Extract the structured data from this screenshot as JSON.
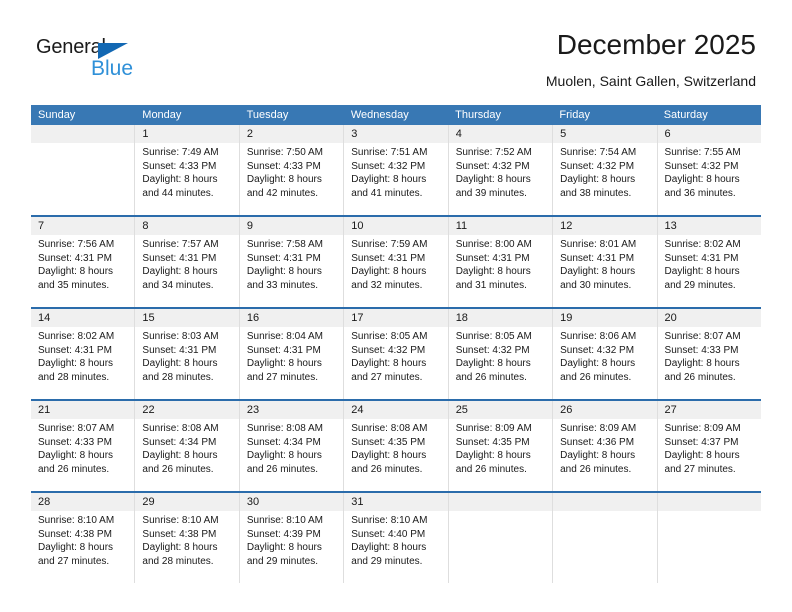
{
  "brand": {
    "name_top": "General",
    "name_bottom": "Blue",
    "accent_color": "#1268b3",
    "accent_color_light": "#2f90d8"
  },
  "header": {
    "title": "December 2025",
    "subtitle": "Muolen, Saint Gallen, Switzerland"
  },
  "theme": {
    "header_row_bg": "#3878b4",
    "week_separator": "#2b6cab",
    "day_number_band_bg": "#f0f0f0",
    "text": "#1a1a1a"
  },
  "weekdays": [
    "Sunday",
    "Monday",
    "Tuesday",
    "Wednesday",
    "Thursday",
    "Friday",
    "Saturday"
  ],
  "weeks": [
    [
      {
        "day": "",
        "sunrise": "",
        "sunset": "",
        "daylight_line1": "",
        "daylight_line2": "",
        "empty": true
      },
      {
        "day": "1",
        "sunrise": "Sunrise: 7:49 AM",
        "sunset": "Sunset: 4:33 PM",
        "daylight_line1": "Daylight: 8 hours",
        "daylight_line2": "and 44 minutes."
      },
      {
        "day": "2",
        "sunrise": "Sunrise: 7:50 AM",
        "sunset": "Sunset: 4:33 PM",
        "daylight_line1": "Daylight: 8 hours",
        "daylight_line2": "and 42 minutes."
      },
      {
        "day": "3",
        "sunrise": "Sunrise: 7:51 AM",
        "sunset": "Sunset: 4:32 PM",
        "daylight_line1": "Daylight: 8 hours",
        "daylight_line2": "and 41 minutes."
      },
      {
        "day": "4",
        "sunrise": "Sunrise: 7:52 AM",
        "sunset": "Sunset: 4:32 PM",
        "daylight_line1": "Daylight: 8 hours",
        "daylight_line2": "and 39 minutes."
      },
      {
        "day": "5",
        "sunrise": "Sunrise: 7:54 AM",
        "sunset": "Sunset: 4:32 PM",
        "daylight_line1": "Daylight: 8 hours",
        "daylight_line2": "and 38 minutes."
      },
      {
        "day": "6",
        "sunrise": "Sunrise: 7:55 AM",
        "sunset": "Sunset: 4:32 PM",
        "daylight_line1": "Daylight: 8 hours",
        "daylight_line2": "and 36 minutes."
      }
    ],
    [
      {
        "day": "7",
        "sunrise": "Sunrise: 7:56 AM",
        "sunset": "Sunset: 4:31 PM",
        "daylight_line1": "Daylight: 8 hours",
        "daylight_line2": "and 35 minutes."
      },
      {
        "day": "8",
        "sunrise": "Sunrise: 7:57 AM",
        "sunset": "Sunset: 4:31 PM",
        "daylight_line1": "Daylight: 8 hours",
        "daylight_line2": "and 34 minutes."
      },
      {
        "day": "9",
        "sunrise": "Sunrise: 7:58 AM",
        "sunset": "Sunset: 4:31 PM",
        "daylight_line1": "Daylight: 8 hours",
        "daylight_line2": "and 33 minutes."
      },
      {
        "day": "10",
        "sunrise": "Sunrise: 7:59 AM",
        "sunset": "Sunset: 4:31 PM",
        "daylight_line1": "Daylight: 8 hours",
        "daylight_line2": "and 32 minutes."
      },
      {
        "day": "11",
        "sunrise": "Sunrise: 8:00 AM",
        "sunset": "Sunset: 4:31 PM",
        "daylight_line1": "Daylight: 8 hours",
        "daylight_line2": "and 31 minutes."
      },
      {
        "day": "12",
        "sunrise": "Sunrise: 8:01 AM",
        "sunset": "Sunset: 4:31 PM",
        "daylight_line1": "Daylight: 8 hours",
        "daylight_line2": "and 30 minutes."
      },
      {
        "day": "13",
        "sunrise": "Sunrise: 8:02 AM",
        "sunset": "Sunset: 4:31 PM",
        "daylight_line1": "Daylight: 8 hours",
        "daylight_line2": "and 29 minutes."
      }
    ],
    [
      {
        "day": "14",
        "sunrise": "Sunrise: 8:02 AM",
        "sunset": "Sunset: 4:31 PM",
        "daylight_line1": "Daylight: 8 hours",
        "daylight_line2": "and 28 minutes."
      },
      {
        "day": "15",
        "sunrise": "Sunrise: 8:03 AM",
        "sunset": "Sunset: 4:31 PM",
        "daylight_line1": "Daylight: 8 hours",
        "daylight_line2": "and 28 minutes."
      },
      {
        "day": "16",
        "sunrise": "Sunrise: 8:04 AM",
        "sunset": "Sunset: 4:31 PM",
        "daylight_line1": "Daylight: 8 hours",
        "daylight_line2": "and 27 minutes."
      },
      {
        "day": "17",
        "sunrise": "Sunrise: 8:05 AM",
        "sunset": "Sunset: 4:32 PM",
        "daylight_line1": "Daylight: 8 hours",
        "daylight_line2": "and 27 minutes."
      },
      {
        "day": "18",
        "sunrise": "Sunrise: 8:05 AM",
        "sunset": "Sunset: 4:32 PM",
        "daylight_line1": "Daylight: 8 hours",
        "daylight_line2": "and 26 minutes."
      },
      {
        "day": "19",
        "sunrise": "Sunrise: 8:06 AM",
        "sunset": "Sunset: 4:32 PM",
        "daylight_line1": "Daylight: 8 hours",
        "daylight_line2": "and 26 minutes."
      },
      {
        "day": "20",
        "sunrise": "Sunrise: 8:07 AM",
        "sunset": "Sunset: 4:33 PM",
        "daylight_line1": "Daylight: 8 hours",
        "daylight_line2": "and 26 minutes."
      }
    ],
    [
      {
        "day": "21",
        "sunrise": "Sunrise: 8:07 AM",
        "sunset": "Sunset: 4:33 PM",
        "daylight_line1": "Daylight: 8 hours",
        "daylight_line2": "and 26 minutes."
      },
      {
        "day": "22",
        "sunrise": "Sunrise: 8:08 AM",
        "sunset": "Sunset: 4:34 PM",
        "daylight_line1": "Daylight: 8 hours",
        "daylight_line2": "and 26 minutes."
      },
      {
        "day": "23",
        "sunrise": "Sunrise: 8:08 AM",
        "sunset": "Sunset: 4:34 PM",
        "daylight_line1": "Daylight: 8 hours",
        "daylight_line2": "and 26 minutes."
      },
      {
        "day": "24",
        "sunrise": "Sunrise: 8:08 AM",
        "sunset": "Sunset: 4:35 PM",
        "daylight_line1": "Daylight: 8 hours",
        "daylight_line2": "and 26 minutes."
      },
      {
        "day": "25",
        "sunrise": "Sunrise: 8:09 AM",
        "sunset": "Sunset: 4:35 PM",
        "daylight_line1": "Daylight: 8 hours",
        "daylight_line2": "and 26 minutes."
      },
      {
        "day": "26",
        "sunrise": "Sunrise: 8:09 AM",
        "sunset": "Sunset: 4:36 PM",
        "daylight_line1": "Daylight: 8 hours",
        "daylight_line2": "and 26 minutes."
      },
      {
        "day": "27",
        "sunrise": "Sunrise: 8:09 AM",
        "sunset": "Sunset: 4:37 PM",
        "daylight_line1": "Daylight: 8 hours",
        "daylight_line2": "and 27 minutes."
      }
    ],
    [
      {
        "day": "28",
        "sunrise": "Sunrise: 8:10 AM",
        "sunset": "Sunset: 4:38 PM",
        "daylight_line1": "Daylight: 8 hours",
        "daylight_line2": "and 27 minutes."
      },
      {
        "day": "29",
        "sunrise": "Sunrise: 8:10 AM",
        "sunset": "Sunset: 4:38 PM",
        "daylight_line1": "Daylight: 8 hours",
        "daylight_line2": "and 28 minutes."
      },
      {
        "day": "30",
        "sunrise": "Sunrise: 8:10 AM",
        "sunset": "Sunset: 4:39 PM",
        "daylight_line1": "Daylight: 8 hours",
        "daylight_line2": "and 29 minutes."
      },
      {
        "day": "31",
        "sunrise": "Sunrise: 8:10 AM",
        "sunset": "Sunset: 4:40 PM",
        "daylight_line1": "Daylight: 8 hours",
        "daylight_line2": "and 29 minutes."
      },
      {
        "day": "",
        "sunrise": "",
        "sunset": "",
        "daylight_line1": "",
        "daylight_line2": "",
        "empty": true
      },
      {
        "day": "",
        "sunrise": "",
        "sunset": "",
        "daylight_line1": "",
        "daylight_line2": "",
        "empty": true
      },
      {
        "day": "",
        "sunrise": "",
        "sunset": "",
        "daylight_line1": "",
        "daylight_line2": "",
        "empty": true
      }
    ]
  ]
}
